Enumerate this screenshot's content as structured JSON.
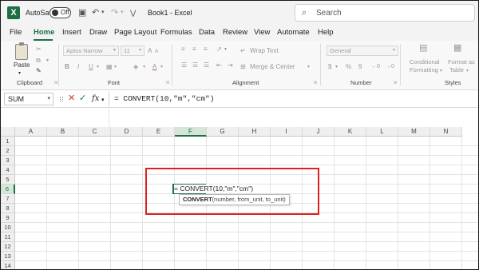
{
  "titlebar": {
    "autosave_label": "AutoSave",
    "toggle_state": "Off",
    "doc_title": "Book1  -  Excel",
    "search_placeholder": "Search"
  },
  "menu": {
    "tabs": [
      "File",
      "Home",
      "Insert",
      "Draw",
      "Page Layout",
      "Formulas",
      "Data",
      "Review",
      "View",
      "Automate",
      "Help"
    ],
    "active": "Home"
  },
  "ribbon": {
    "clipboard": {
      "paste": "Paste",
      "label": "Clipboard"
    },
    "font": {
      "name": "Aptos Narrow",
      "size": "11",
      "bold": "B",
      "italic": "I",
      "underline": "U",
      "grow": "A",
      "shrink": "A",
      "label": "Font"
    },
    "alignment": {
      "wrap_text": "Wrap Text",
      "merge_center": "Merge & Center",
      "label": "Alignment"
    },
    "number": {
      "format": "General",
      "currency": "$",
      "percent": "%",
      "comma": "9",
      "label": "Number"
    },
    "styles": {
      "conditional": "Conditional",
      "formatting": "Formatting",
      "format_as": "Format as",
      "table": "Table",
      "label": "Styles"
    }
  },
  "formula_bar": {
    "name_box": "SUM",
    "cancel_icon": "✕",
    "enter_icon": "✓",
    "fx": "fx",
    "formula": "= CONVERT(10,\"m\",\"cm\")"
  },
  "grid": {
    "columns": [
      "A",
      "B",
      "C",
      "D",
      "E",
      "F",
      "G",
      "H",
      "I",
      "J",
      "K",
      "L",
      "M",
      "N"
    ],
    "rows": [
      "1",
      "2",
      "3",
      "4",
      "5",
      "6",
      "7",
      "8",
      "9",
      "10",
      "11",
      "12",
      "13",
      "14"
    ],
    "selected_column": "F",
    "selected_row": "6",
    "active_cell_text": "= CONVERT(10,\"m\",\"cm\")",
    "tooltip_fn": "CONVERT",
    "tooltip_args": "(number, from_unit, to_unit)"
  },
  "colors": {
    "excel_green": "#1d6f42",
    "highlight_red": "#e02020"
  }
}
